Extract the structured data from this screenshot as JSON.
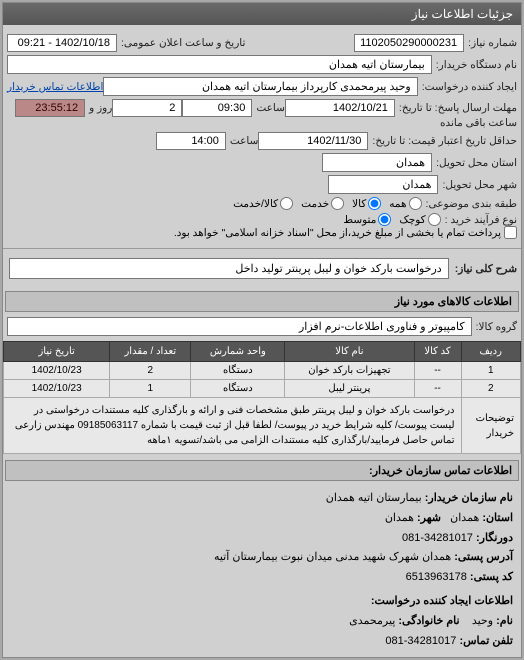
{
  "header": {
    "title": "جزئیات اطلاعات نیاز"
  },
  "form": {
    "reqNo_lbl": "شماره نیاز:",
    "reqNo": "1102050290000231",
    "pubDate_lbl": "تاریخ و ساعت اعلان عمومی:",
    "pubDate": "1402/10/18 - 09:21",
    "org_lbl": "نام دستگاه خریدار:",
    "org": "بیمارستان اتیه همدان",
    "creator_lbl": "ایجاد کننده درخواست:",
    "creator": "وحید پیرمحمدی کارپرداز بیمارستان اتیه همدان",
    "contactLink": "اطلاعات تماس خریدار",
    "respDeadline_lbl": "مهلت ارسال پاسخ: تا تاریخ:",
    "respDate": "1402/10/21",
    "time_lbl": "ساعت",
    "respTime": "09:30",
    "remain_lbl": "روز و",
    "remainDays": "2",
    "remainTime": "23:55:12",
    "remainSuffix": "ساعت باقی مانده",
    "priceValidity_lbl": "حداقل تاریخ اعتبار قیمت: تا تاریخ:",
    "priceDate": "1402/11/30",
    "priceTime": "14:00",
    "province_lbl": "استان محل تحویل:",
    "province": "همدان",
    "city_lbl": "شهر محل تحویل:",
    "city": "همدان",
    "category_lbl": "طبقه بندی موضوعی:",
    "radio_all": "همه",
    "radio_goods": "کالا",
    "radio_service": "خدمت",
    "radio_goodservice": "کالا/خدمت",
    "process_lbl": "نوع فرآیند خرید :",
    "radio_small": "کوچک",
    "radio_medium": "متوسط",
    "processNote": "پرداخت تمام یا بخشی از مبلغ خرید،از محل \"اسناد خزانه اسلامی\" خواهد بود."
  },
  "titles": {
    "mainTitle_lbl": "شرح کلی نیاز:",
    "mainTitle": "درخواست بارکد خوان و لیبل پرینتر تولید داخل",
    "itemsHeader": "اطلاعات کالاهای مورد نیاز",
    "group_lbl": "گروه کالا:",
    "group": "کامپیوتر و فناوری اطلاعات-نرم افزار"
  },
  "table": {
    "headers": [
      "ردیف",
      "کد کالا",
      "نام کالا",
      "واحد شمارش",
      "تعداد / مقدار",
      "تاریخ نیاز"
    ],
    "rows": [
      [
        "1",
        "--",
        "تجهیزات بارکد خوان",
        "دستگاه",
        "2",
        "1402/10/23"
      ],
      [
        "2",
        "--",
        "پرینتر لیبل",
        "دستگاه",
        "1",
        "1402/10/23"
      ]
    ],
    "desc_lbl": "توضیحات خریدار",
    "desc": "درخواست بارکد خوان و لیبل پرینتر طبق مشخصات فنی و ارائه و بارگذاری کلیه مستندات درخواستی در لیست پیوست/ کلیه شرایط خرید در پیوست/ لطفا قبل از ثبت قیمت با شماره 09185063117 مهندس زارعی تماس حاصل فرمایید/بارگذاری کلیه مستندات الزامی می باشد/تسویه ۱ماهه"
  },
  "contact": {
    "header": "اطلاعات تماس سازمان خریدار:",
    "orgName_lbl": "نام سازمان خریدار:",
    "orgName": "بیمارستان اتیه همدان",
    "province_lbl": "استان:",
    "province": "همدان",
    "city_lbl": "شهر:",
    "city": "همدان",
    "fax_lbl": "دورنگار:",
    "fax": "34281017-081",
    "address_lbl": "آدرس پستی:",
    "address": "همدان شهرک شهید مدنی میدان نبوت بیمارستان آتیه",
    "postal_lbl": "کد پستی:",
    "postal": "6513963178",
    "creatorHeader": "اطلاعات ایجاد کننده درخواست:",
    "name_lbl": "نام:",
    "name": "وحید",
    "family_lbl": "نام خانوادگی:",
    "family": "پیرمحمدی",
    "phone_lbl": "تلفن تماس:",
    "phone": "34281017-081"
  }
}
